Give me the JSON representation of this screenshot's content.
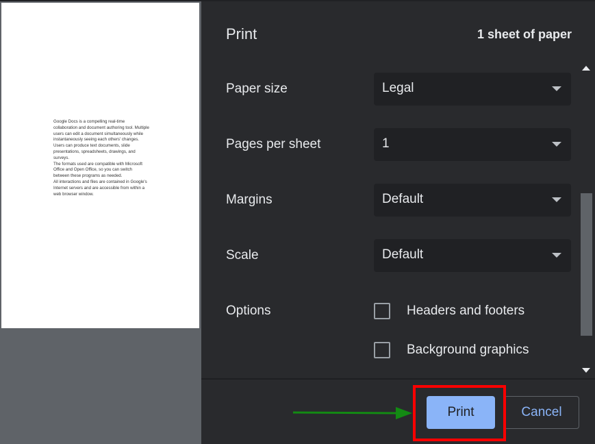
{
  "preview": {
    "paragraphs": [
      "Google Docs is a compelling real-time collaboration and document authoring tool. Multiple users can edit a document simultaneously while instantaneously seeing each others' changes.",
      "Users can produce text documents, slide presentations, spreadsheets, drawings, and surveys.",
      "The formats used are compatible with Microsoft Office and Open Office, so you can switch between these programs as needed.",
      "All interactions and files are contained in Google's Internet servers and are accessible from within a web browser window."
    ]
  },
  "dialog": {
    "title": "Print",
    "sheet_count": "1 sheet of paper"
  },
  "settings": {
    "paper_size": {
      "label": "Paper size",
      "value": "Legal"
    },
    "pages_per_sheet": {
      "label": "Pages per sheet",
      "value": "1"
    },
    "margins": {
      "label": "Margins",
      "value": "Default"
    },
    "scale": {
      "label": "Scale",
      "value": "Default"
    },
    "options": {
      "label": "Options",
      "headers_footers": {
        "label": "Headers and footers",
        "checked": false
      },
      "background_graphics": {
        "label": "Background graphics",
        "checked": false
      }
    }
  },
  "buttons": {
    "print": "Print",
    "cancel": "Cancel"
  },
  "colors": {
    "panel_bg": "#292a2d",
    "select_bg": "#202124",
    "accent": "#8ab4f8",
    "highlight": "#ff0000",
    "arrow": "#138a13"
  },
  "icons": {
    "dropdown": "chevron-down-icon",
    "scroll_up": "scroll-up-icon",
    "scroll_down": "scroll-down-icon",
    "annotation_arrow": "arrow-right-icon"
  }
}
